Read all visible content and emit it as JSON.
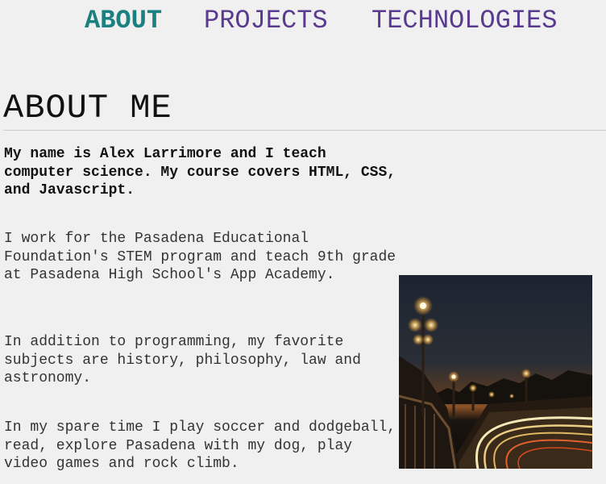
{
  "nav": {
    "items": [
      {
        "label": "ABOUT",
        "active": true
      },
      {
        "label": "PROJECTS",
        "active": false
      },
      {
        "label": "TECHNOLOGIES",
        "active": false
      }
    ]
  },
  "main": {
    "title": "ABOUT ME",
    "intro": "My name is Alex Larrimore and I teach computer science. My course covers HTML, CSS, and Javascript.",
    "paragraphs": [
      "I work for the Pasadena Educational Foundation's STEM program and teach 9th grade at Pasadena High School's App Academy.",
      "In addition to programming, my favorite subjects are history, philosophy, law and astronomy.",
      "In my spare time I play soccer and dodgeball, read, explore Pasadena with my dog, play video games and rock climb."
    ]
  },
  "colors": {
    "background": "#f0f0f0",
    "nav_active": "#1a8080",
    "nav_link": "#5a3a8e"
  }
}
